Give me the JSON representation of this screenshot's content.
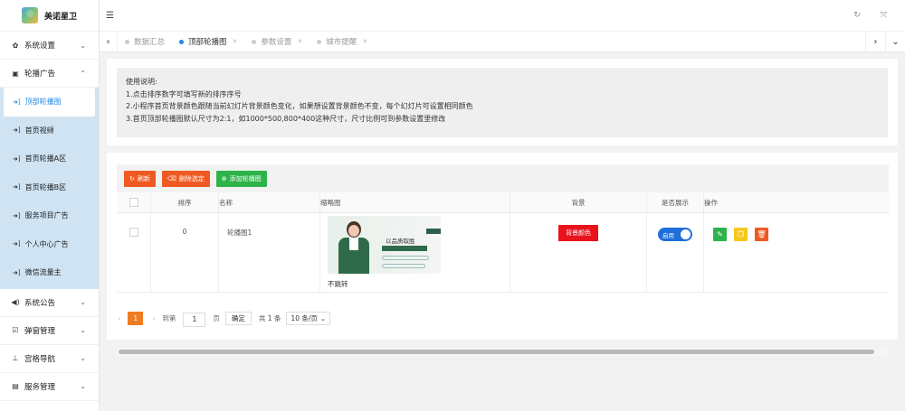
{
  "app": {
    "name": "美诺星卫"
  },
  "sidebar": {
    "menus": [
      {
        "label": "系统设置",
        "icon": "gear-icon"
      },
      {
        "label": "轮播广告",
        "icon": "image-icon"
      }
    ],
    "submenu": [
      {
        "label": "顶部轮播图",
        "active": true
      },
      {
        "label": "首页视频"
      },
      {
        "label": "首页轮播A区"
      },
      {
        "label": "首页轮播B区"
      },
      {
        "label": "服务项目广告"
      },
      {
        "label": "个人中心广告"
      },
      {
        "label": "微信流量主"
      }
    ],
    "menus_bottom": [
      {
        "label": "系统公告",
        "icon": "speaker-icon"
      },
      {
        "label": "弹窗管理",
        "icon": "checkbox-icon"
      },
      {
        "label": "宫格导航",
        "icon": "sitemap-icon"
      },
      {
        "label": "服务管理",
        "icon": "list-icon"
      }
    ]
  },
  "tabs": [
    {
      "label": "数据汇总",
      "active": false
    },
    {
      "label": "顶部轮播图",
      "active": true
    },
    {
      "label": "参数设置",
      "active": false
    },
    {
      "label": "城市提醒",
      "active": false
    }
  ],
  "notice": {
    "title": "使用说明:",
    "lines": [
      "1.点击排序数字可填写新的排序序号",
      "2.小程序首页背景颜色跟随当前幻灯片背景颜色变化，如果想设置背景颜色不变，每个幻灯片可设置相同颜色",
      "3.首页顶部轮播图默认尺寸为2:1，如1000*500,800*400这种尺寸，尺寸比例可到参数设置里修改"
    ]
  },
  "toolbar": {
    "refresh": "刷新",
    "delete_selected": "删除选定",
    "add": "添加轮播图"
  },
  "table": {
    "headers": [
      "排序",
      "名称",
      "缩略图",
      "背景",
      "是否展示",
      "操作"
    ],
    "rows": [
      {
        "order": "0",
        "name": "轮播图1",
        "thumb_text": "以品质取胜",
        "thumb_caption": "不跳转",
        "bg_label": "背景颜色",
        "bg_color": "#e8131b",
        "show_label": "启用"
      }
    ]
  },
  "pager": {
    "current": "1",
    "goto_label": "到第",
    "goto_value": "1",
    "page_unit": "页",
    "confirm": "确定",
    "total": "共 1 条",
    "page_size": "10 条/页"
  },
  "colors": {
    "accent": "#1e88e5",
    "orange": "#f05a22",
    "green": "#2eb34b",
    "red": "#e8131b"
  }
}
